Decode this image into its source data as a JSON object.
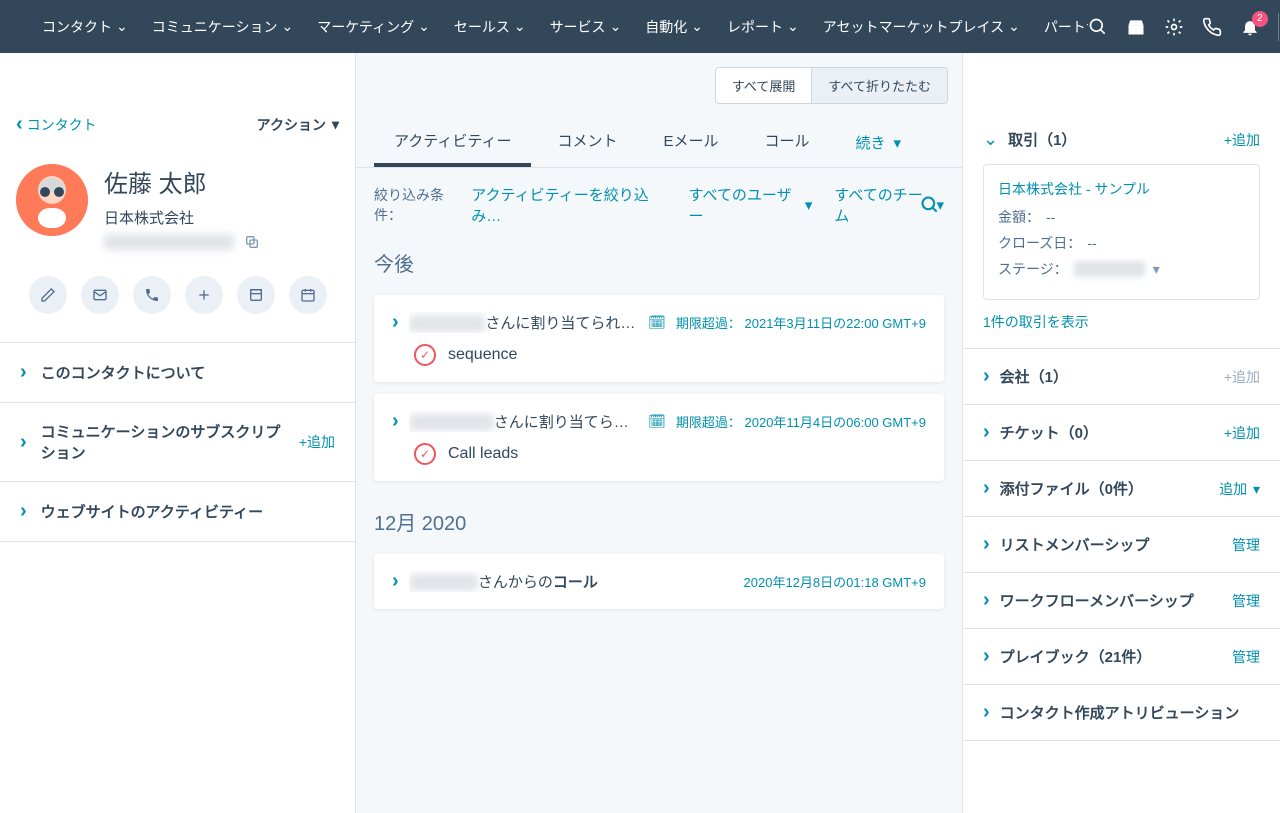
{
  "nav": {
    "items": [
      "コンタクト",
      "コミュニケーション",
      "マーケティング",
      "セールス",
      "サービス",
      "自動化",
      "レポート",
      "アセットマーケットプレイス",
      "パートナー"
    ],
    "badge": "2"
  },
  "left": {
    "back": "コンタクト",
    "actions": "アクション",
    "name": "佐藤 太郎",
    "company": "日本株式会社",
    "email_masked": "xxxxxxxxx@xxxx.xxx",
    "accordion": [
      {
        "label": "このコンタクトについて",
        "action": ""
      },
      {
        "label": "コミュニケーションのサブスクリプション",
        "action": "+追加"
      },
      {
        "label": "ウェブサイトのアクティビティー",
        "action": ""
      }
    ]
  },
  "mid": {
    "expand_all": "すべて展開",
    "collapse_all": "すべて折りたたむ",
    "tabs": [
      "アクティビティー",
      "コメント",
      "Eメール",
      "コール",
      "続き"
    ],
    "filter_label": "絞り込み条件：",
    "filters": [
      "アクティビティーを絞り込み…",
      "すべてのユーザー",
      "すべてのチーム"
    ],
    "section_upcoming": "今後",
    "section_dec": "12月 2020",
    "cards": [
      {
        "assignee_masked": "Xxxx Xxxxx",
        "title_rest": "さんに割り当てられた手動E…",
        "overdue_label": "期限超過：",
        "due": "2021年3月11日の22:00 GMT+9",
        "sub": "sequence"
      },
      {
        "assignee_masked": "Xxxxxxxxxxx",
        "title_rest": "さんに割り当てられたタ…",
        "overdue_label": "期限超過：",
        "due": "2020年11月4日の06:00 GMT+9",
        "sub": "Call leads"
      }
    ],
    "call_card": {
      "caller_masked": "Xxxx Xxxx",
      "rest": "さんからの",
      "bold": "コール",
      "time": "2020年12月8日の01:18 GMT+9"
    }
  },
  "right": {
    "deals": {
      "title": "取引（1）",
      "add": "+追加",
      "card": {
        "name": "日本株式会社 - サンプル",
        "amount_label": "金額：",
        "amount": "--",
        "close_label": "クローズ日：",
        "close": "--",
        "stage_label": "ステージ：",
        "stage_masked": "xxxxx"
      },
      "show": "1件の取引を表示"
    },
    "sections": [
      {
        "title": "会社（1）",
        "action": "+追加",
        "muted": true
      },
      {
        "title": "チケット（0）",
        "action": "+追加",
        "muted": false
      },
      {
        "title": "添付ファイル（0件）",
        "action": "追加",
        "muted": false,
        "dropdown": true
      },
      {
        "title": "リストメンバーシップ",
        "action": "管理",
        "muted": false
      },
      {
        "title": "ワークフローメンバーシップ",
        "action": "管理",
        "muted": false
      },
      {
        "title": "プレイブック（21件）",
        "action": "管理",
        "muted": false
      },
      {
        "title": "コンタクト作成アトリビューション",
        "action": "",
        "muted": false
      }
    ]
  }
}
